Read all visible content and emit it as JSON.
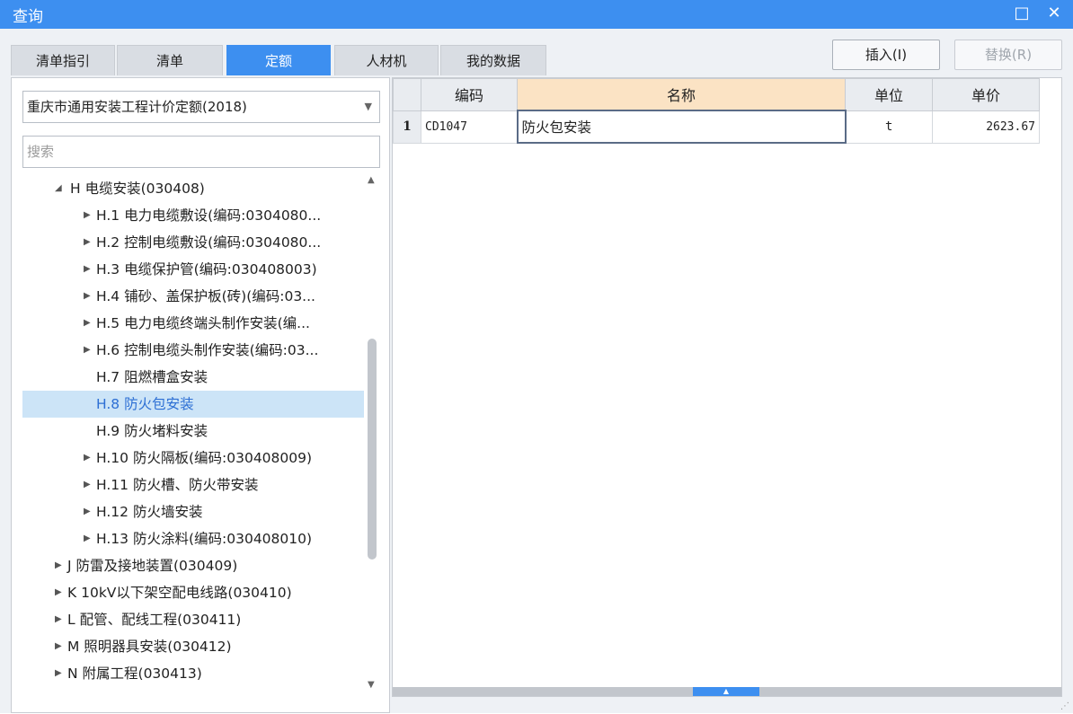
{
  "window": {
    "title": "查询",
    "maximize_icon": "maximize-icon",
    "close_icon": "close-icon"
  },
  "tabs": [
    {
      "label": "清单指引",
      "active": false
    },
    {
      "label": "清单",
      "active": false
    },
    {
      "label": "定额",
      "active": true
    },
    {
      "label": "人材机",
      "active": false
    },
    {
      "label": "我的数据",
      "active": false
    }
  ],
  "toolbar": {
    "insert_label": "插入(I)",
    "replace_label": "替换(R)",
    "replace_disabled": true
  },
  "library_select": {
    "value": "重庆市通用安装工程计价定额(2018)"
  },
  "search": {
    "placeholder": "搜索"
  },
  "tree": [
    {
      "label": "H 电缆安装(030408)",
      "expanded": true,
      "level": 1
    },
    {
      "label": "H.1 电力电缆敷设(编码:0304080...",
      "level": 2,
      "has_children": true
    },
    {
      "label": "H.2 控制电缆敷设(编码:0304080...",
      "level": 2,
      "has_children": true
    },
    {
      "label": "H.3 电缆保护管(编码:030408003)",
      "level": 2,
      "has_children": true
    },
    {
      "label": "H.4 铺砂、盖保护板(砖)(编码:03...",
      "level": 2,
      "has_children": true
    },
    {
      "label": "H.5 电力电缆终端头制作安装(编...",
      "level": 2,
      "has_children": true
    },
    {
      "label": "H.6 控制电缆头制作安装(编码:03...",
      "level": 2,
      "has_children": true
    },
    {
      "label": "H.7 阻燃槽盒安装",
      "level": 2,
      "has_children": false
    },
    {
      "label": "H.8 防火包安装",
      "level": 2,
      "has_children": false,
      "selected": true
    },
    {
      "label": "H.9 防火堵料安装",
      "level": 2,
      "has_children": false
    },
    {
      "label": "H.10 防火隔板(编码:030408009)",
      "level": 2,
      "has_children": true
    },
    {
      "label": "H.11 防火槽、防火带安装",
      "level": 2,
      "has_children": true
    },
    {
      "label": "H.12 防火墙安装",
      "level": 2,
      "has_children": true
    },
    {
      "label": "H.13 防火涂料(编码:030408010)",
      "level": 2,
      "has_children": true
    },
    {
      "label": "J 防雷及接地装置(030409)",
      "level": 1,
      "has_children": true
    },
    {
      "label": "K 10kV以下架空配电线路(030410)",
      "level": 1,
      "has_children": true
    },
    {
      "label": "L 配管、配线工程(030411)",
      "level": 1,
      "has_children": true
    },
    {
      "label": "M 照明器具安装(030412)",
      "level": 1,
      "has_children": true
    },
    {
      "label": "N 附属工程(030413)",
      "level": 1,
      "has_children": true
    }
  ],
  "table": {
    "headers": {
      "code": "编码",
      "name": "名称",
      "unit": "单位",
      "price": "单价"
    },
    "rows": [
      {
        "num": "1",
        "code": "CD1047",
        "name": "防火包安装",
        "unit": "t",
        "price": "2623.67"
      }
    ]
  }
}
